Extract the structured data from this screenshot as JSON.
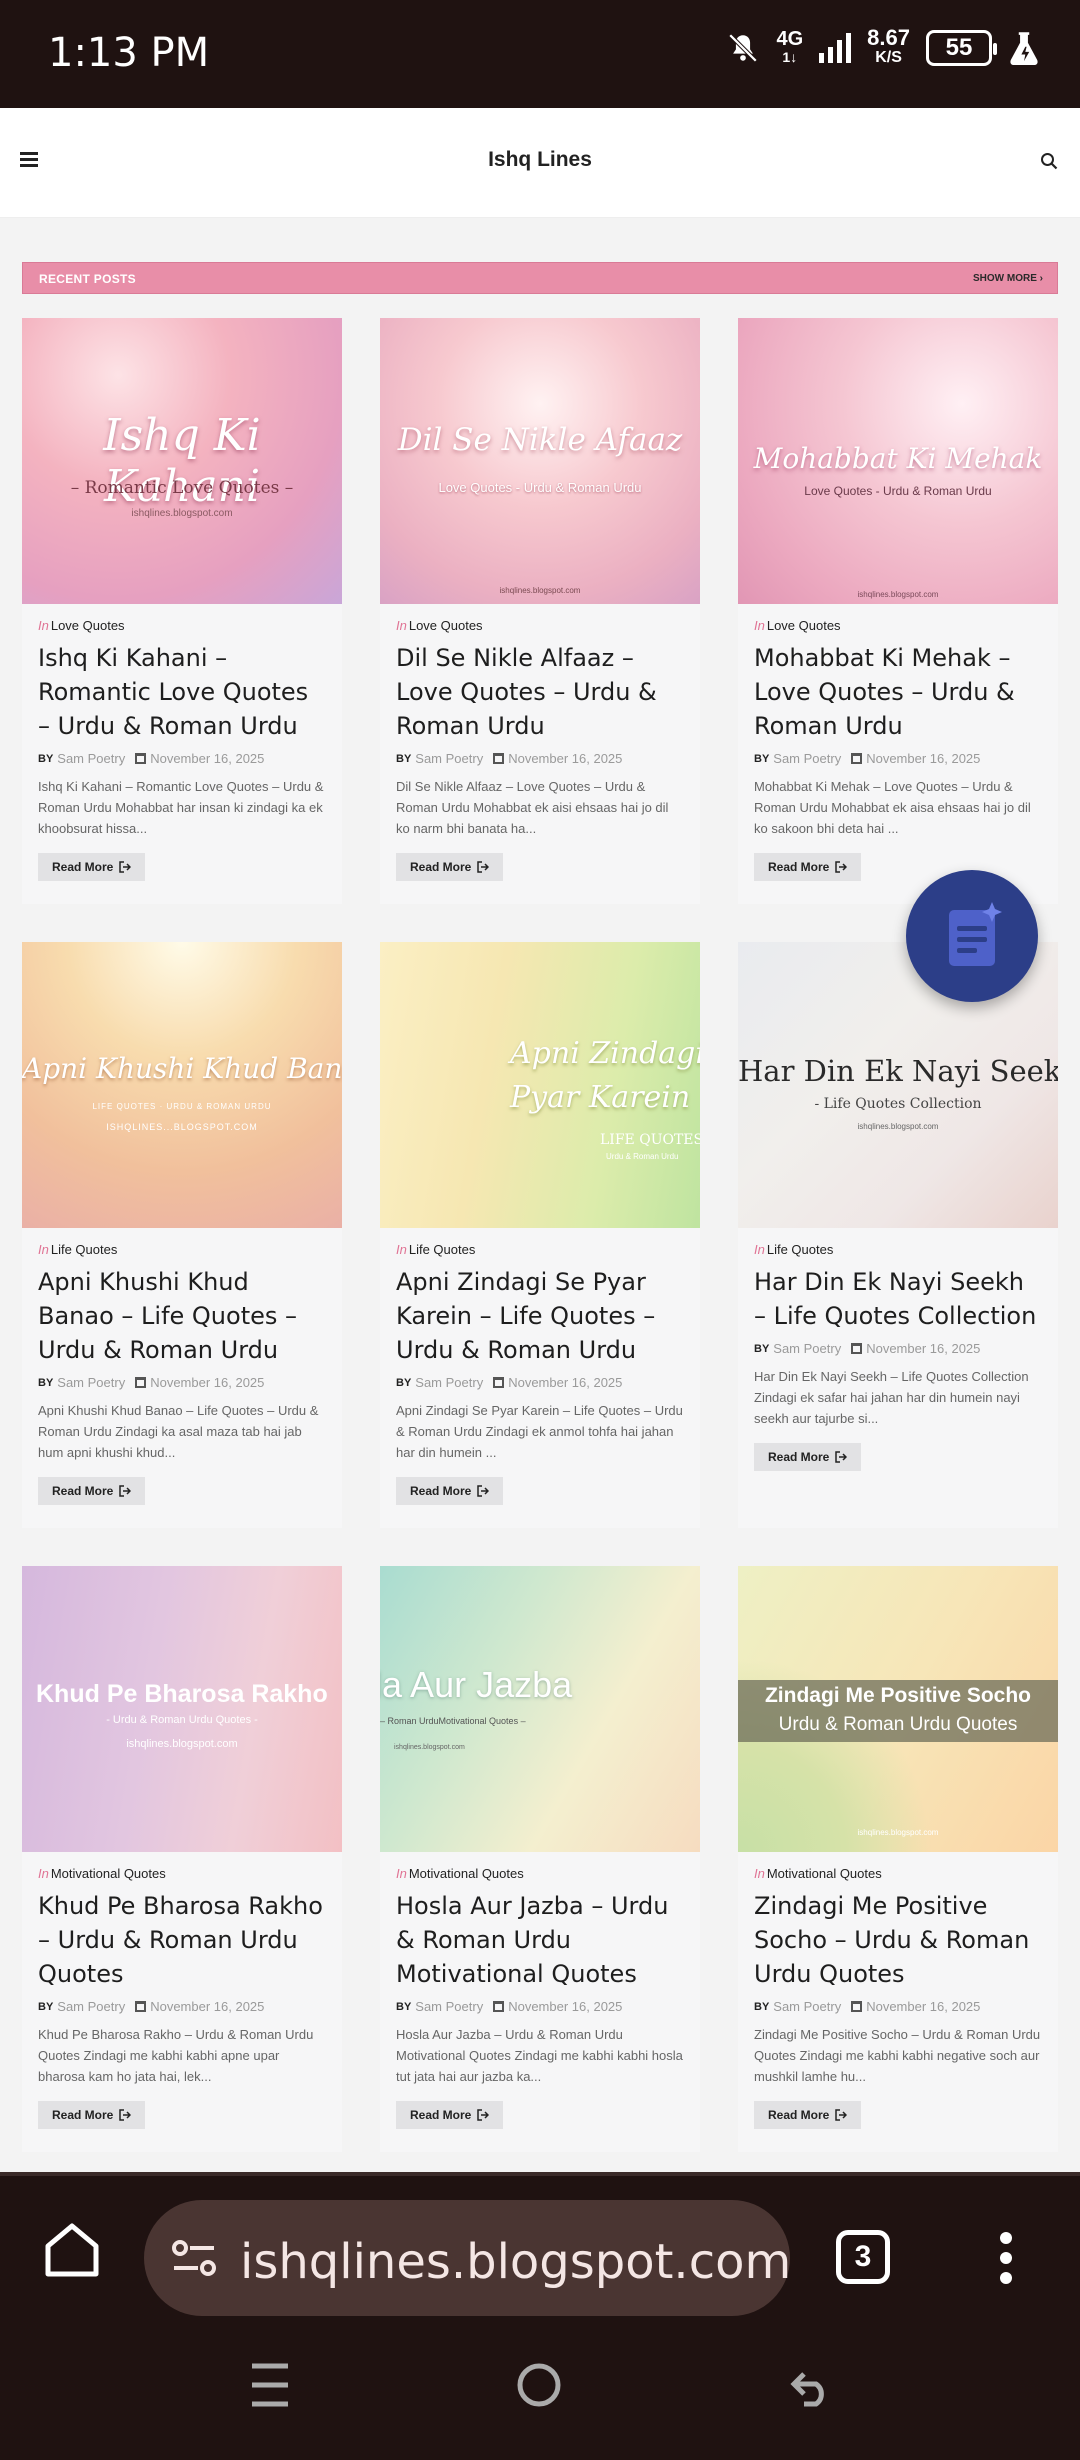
{
  "status_bar": {
    "time": "1:13 PM",
    "network_top": "4G",
    "network_bottom": "1↓",
    "speed_value": "8.67",
    "speed_unit": "K/S",
    "battery": "55"
  },
  "header": {
    "site_title": "Ishq Lines"
  },
  "section": {
    "title": "RECENT POSTS",
    "show_more": "SHOW MORE ›"
  },
  "common": {
    "in_label": "In",
    "by_label": "BY",
    "read_more": "Read More"
  },
  "posts": [
    {
      "thumb_title": "Ishq Ki Kahani",
      "thumb_sub": "–  Romantic Love Quotes  –",
      "thumb_site": "ishqlines.blogspot.com",
      "category": "Love Quotes",
      "title": "Ishq Ki Kahani – Romantic Love Quotes – Urdu & Roman Urdu",
      "author": "Sam Poetry",
      "date": "November 16, 2025",
      "excerpt": "Ishq Ki Kahani – Romantic Love Quotes – Urdu & Roman Urdu Mohabbat har insan ki zindagi ka ek khoobsurat hissa..."
    },
    {
      "thumb_title": "Dil Se Nikle Afaaz",
      "thumb_sub": "Love Quotes - Urdu & Roman Urdu",
      "thumb_site": "ishqlines.blogspot.com",
      "category": "Love Quotes",
      "title": "Dil Se Nikle Alfaaz – Love Quotes – Urdu & Roman Urdu",
      "author": "Sam Poetry",
      "date": "November 16, 2025",
      "excerpt": "Dil Se Nikle Alfaaz – Love Quotes – Urdu & Roman Urdu Mohabbat ek aisi ehsaas hai jo dil ko narm bhi banata ha..."
    },
    {
      "thumb_title": "Mohabbat Ki Mehak",
      "thumb_sub": "Love Quotes - Urdu & Roman Urdu",
      "thumb_site": "ishqlines.blogspot.com",
      "category": "Love Quotes",
      "title": "Mohabbat Ki Mehak – Love Quotes – Urdu & Roman Urdu",
      "author": "Sam Poetry",
      "date": "November 16, 2025",
      "excerpt": "Mohabbat Ki Mehak – Love Quotes – Urdu & Roman Urdu Mohabbat ek aisa ehsaas hai jo dil ko sakoon bhi deta hai ..."
    },
    {
      "thumb_title": "Apni Khushi Khud Banao",
      "thumb_sub": "LIFE QUOTES · URDU & ROMAN URDU",
      "thumb_site": "ISHQLINES...BLOGSPOT.COM",
      "category": "Life Quotes",
      "title": "Apni Khushi Khud Banao – Life Quotes – Urdu & Roman Urdu",
      "author": "Sam Poetry",
      "date": "November 16, 2025",
      "excerpt": "Apni Khushi Khud Banao – Life Quotes – Urdu & Roman Urdu Zindagi ka asal maza tab hai jab hum apni khushi khud..."
    },
    {
      "thumb_title": "Apni Zindagi Se Pyar Karein",
      "thumb_sub": "LIFE QUOTES",
      "thumb_site": "Urdu & Roman Urdu",
      "category": "Life Quotes",
      "title": "Apni Zindagi Se Pyar Karein – Life Quotes – Urdu & Roman Urdu",
      "author": "Sam Poetry",
      "date": "November 16, 2025",
      "excerpt": "Apni Zindagi Se Pyar Karein – Life Quotes – Urdu & Roman Urdu Zindagi ek anmol tohfa hai jahan har din humein ..."
    },
    {
      "thumb_title": "Har Din Ek Nayi Seekh",
      "thumb_sub": "- Life Quotes Collection",
      "thumb_site": "ishqlines.blogspot.com",
      "category": "Life Quotes",
      "title": "Har Din Ek Nayi Seekh – Life Quotes Collection",
      "author": "Sam Poetry",
      "date": "November 16, 2025",
      "excerpt": "Har Din Ek Nayi Seekh – Life Quotes Collection Zindagi ek safar hai jahan har din humein nayi seekh aur tajurbe si..."
    },
    {
      "thumb_title": "Khud Pe Bharosa Rakho",
      "thumb_sub": "- Urdu & Roman Urdu Quotes -",
      "thumb_site": "ishqlines.blogspot.com",
      "category": "Motivational Quotes",
      "title": "Khud Pe Bharosa Rakho – Urdu & Roman Urdu Quotes",
      "author": "Sam Poetry",
      "date": "November 16, 2025",
      "excerpt": "Khud Pe Bharosa Rakho – Urdu & Roman Urdu Quotes Zindagi me kabhi kabhi apne upar bharosa kam ho jata hai, lek..."
    },
    {
      "thumb_title": "Hosla Aur Jazba",
      "thumb_sub": "– Roman UrduMotivational Quotes –",
      "thumb_site": "ishqlines.blogspot.com",
      "category": "Motivational Quotes",
      "title": "Hosla Aur Jazba – Urdu & Roman Urdu Motivational Quotes",
      "author": "Sam Poetry",
      "date": "November 16, 2025",
      "excerpt": "Hosla Aur Jazba – Urdu & Roman Urdu Motivational Quotes Zindagi me kabhi kabhi hosla tut jata hai aur jazba ka..."
    },
    {
      "thumb_title": "Zindagi Me Positive Socho",
      "thumb_sub": "Urdu & Roman Urdu Quotes",
      "thumb_site": "ishqlines.blogspot.com",
      "category": "Motivational Quotes",
      "title": "Zindagi Me Positive Socho – Urdu & Roman Urdu Quotes",
      "author": "Sam Poetry",
      "date": "November 16, 2025",
      "excerpt": "Zindagi Me Positive Socho – Urdu & Roman Urdu Quotes Zindagi me kabhi kabhi negative soch aur mushkil lamhe hu..."
    }
  ],
  "browser": {
    "url": "ishqlines.blogspot.com",
    "tab_count": "3"
  },
  "colors": {
    "accent_pink": "#e88ea8",
    "status_bg": "#1f1211",
    "fab_blue": "#2c3e88"
  },
  "icons": {
    "menu": "hamburger-icon",
    "search": "search-icon",
    "home": "home-icon",
    "site_info": "tune-icon",
    "more": "vertical-dots-icon",
    "fab": "document-icon"
  }
}
